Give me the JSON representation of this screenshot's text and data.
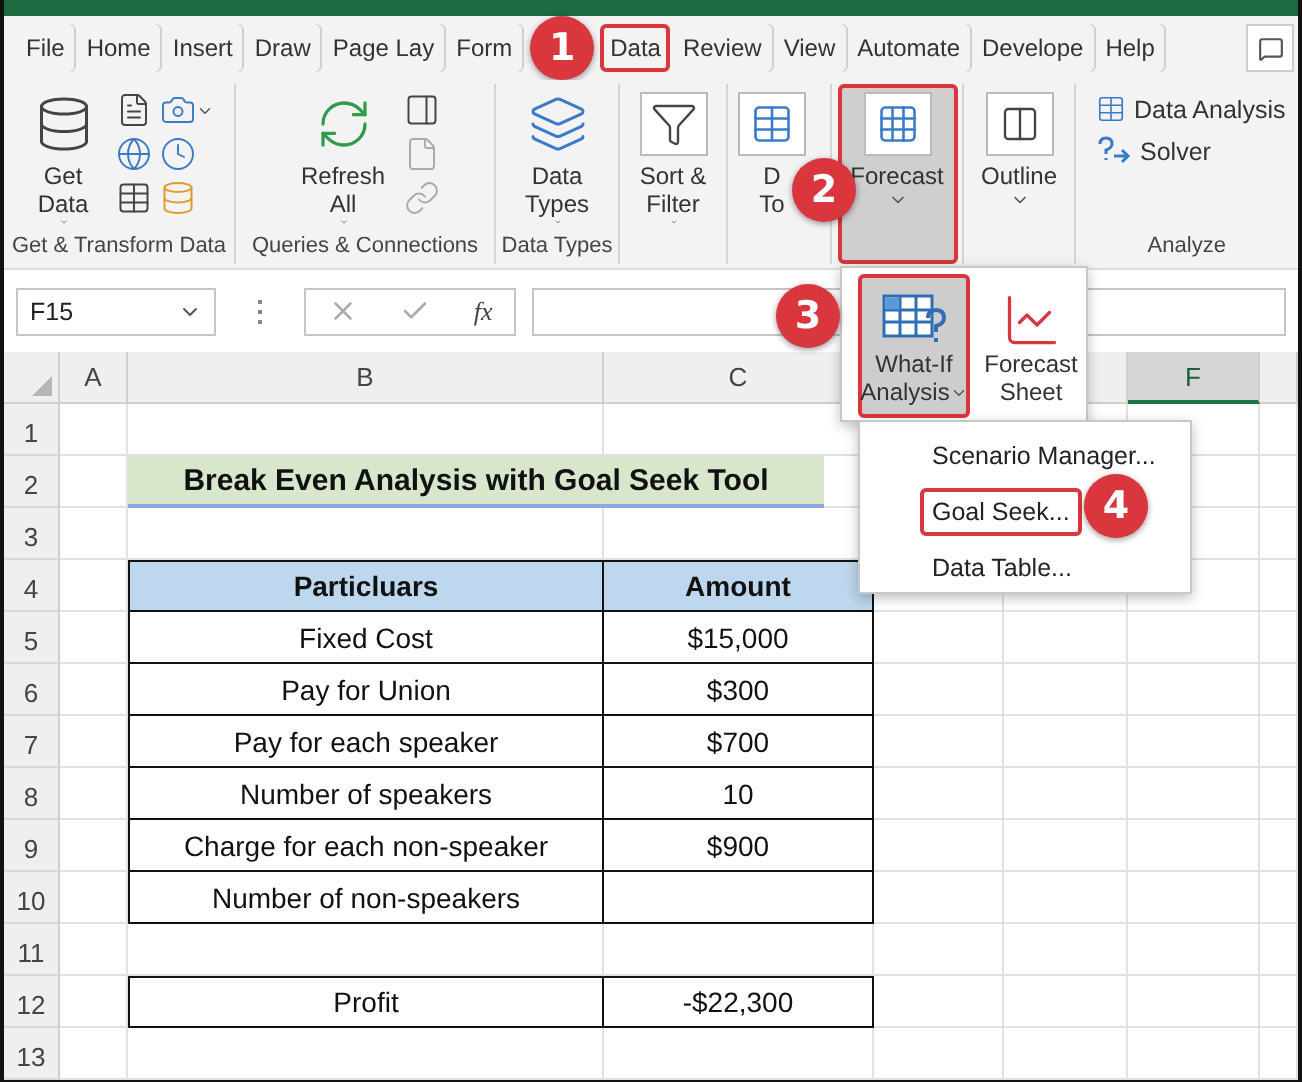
{
  "tabs": [
    {
      "label": "File",
      "selected": false
    },
    {
      "label": "Home",
      "selected": false
    },
    {
      "label": "Insert",
      "selected": false
    },
    {
      "label": "Draw",
      "selected": false
    },
    {
      "label": "Page Lay",
      "selected": false
    },
    {
      "label": "Form",
      "selected": false
    },
    {
      "label": "Data",
      "selected": true
    },
    {
      "label": "Review",
      "selected": false
    },
    {
      "label": "View",
      "selected": false
    },
    {
      "label": "Automate",
      "selected": false
    },
    {
      "label": "Develope",
      "selected": false
    },
    {
      "label": "Help",
      "selected": false
    }
  ],
  "ribbon": {
    "groups": [
      {
        "label": "Get & Transform Data",
        "items": [
          {
            "kind": "large",
            "lines": [
              "Get",
              "Data"
            ],
            "dropdown": true
          },
          {
            "kind": "icon-grid"
          }
        ]
      },
      {
        "label": "Queries & Connections",
        "items": [
          {
            "kind": "large",
            "lines": [
              "Refresh",
              "All"
            ],
            "dropdown": true
          },
          {
            "kind": "icon-column"
          }
        ]
      },
      {
        "label": "Data Types",
        "items": [
          {
            "kind": "large",
            "lines": [
              "Data",
              "Types"
            ],
            "dropdown": true
          }
        ]
      },
      {
        "items": [
          {
            "kind": "large",
            "lines": [
              "Sort &",
              "Filter"
            ],
            "dropdown": true
          }
        ]
      },
      {
        "items": [
          {
            "kind": "large",
            "lines": [
              "D",
              "To"
            ],
            "dropdown": false
          }
        ]
      },
      {
        "items": [
          {
            "kind": "large",
            "lines": [
              "Forecast"
            ],
            "dropdown": true,
            "pressed": true,
            "highlighted": true
          }
        ]
      },
      {
        "items": [
          {
            "kind": "large",
            "lines": [
              "Outline"
            ],
            "dropdown": true
          }
        ]
      },
      {
        "label": "Analyze",
        "items": [
          {
            "kind": "small",
            "label": "Data Analysis"
          },
          {
            "kind": "small",
            "label": "Solver"
          }
        ]
      }
    ]
  },
  "formula_bar": {
    "name_box": "F15",
    "function_label": "fx"
  },
  "columns": [
    {
      "label": "A",
      "selected": false
    },
    {
      "label": "B",
      "selected": false
    },
    {
      "label": "C",
      "selected": false
    },
    {},
    {},
    {
      "label": "F",
      "selected": true
    }
  ],
  "rows": [
    {
      "number": "1",
      "kind": "blank"
    },
    {
      "number": "2",
      "kind": "title",
      "text": "Break Even Analysis with Goal Seek Tool"
    },
    {
      "number": "3",
      "kind": "blank"
    },
    {
      "number": "4",
      "kind": "header",
      "cells": [
        "Particluars",
        "Amount"
      ]
    },
    {
      "number": "5",
      "kind": "data",
      "cells": [
        "Fixed Cost",
        "$15,000"
      ]
    },
    {
      "number": "6",
      "kind": "data",
      "cells": [
        "Pay for Union",
        "$300"
      ]
    },
    {
      "number": "7",
      "kind": "data",
      "cells": [
        "Pay for each speaker",
        "$700"
      ]
    },
    {
      "number": "8",
      "kind": "data",
      "cells": [
        "Number of speakers",
        "10"
      ]
    },
    {
      "number": "9",
      "kind": "data",
      "cells": [
        "Charge for each non-speaker",
        "$900"
      ]
    },
    {
      "number": "10",
      "kind": "data",
      "cells": [
        "Number of non-speakers"
      ]
    },
    {
      "number": "11",
      "kind": "blank"
    },
    {
      "number": "12",
      "kind": "data",
      "cells": [
        "Profit",
        "-$22,300"
      ]
    },
    {
      "number": "13",
      "kind": "blank"
    }
  ],
  "forecast_dropdown": {
    "buttons": [
      {
        "lines": [
          "What-If",
          "Analysis"
        ],
        "dropdown": true,
        "pressed": true,
        "highlighted": true
      },
      {
        "lines": [
          "Forecast",
          "Sheet"
        ],
        "dropdown": false,
        "pressed": false,
        "highlighted": false
      }
    ]
  },
  "what_if_menu": {
    "items": [
      {
        "label": "Scenario Manager...",
        "highlighted": false
      },
      {
        "label": "Goal Seek...",
        "highlighted": true
      },
      {
        "label": "Data Table...",
        "highlighted": false
      }
    ]
  },
  "callouts": [
    {
      "number": "1"
    },
    {
      "number": "2"
    },
    {
      "number": "3"
    },
    {
      "number": "4"
    }
  ]
}
